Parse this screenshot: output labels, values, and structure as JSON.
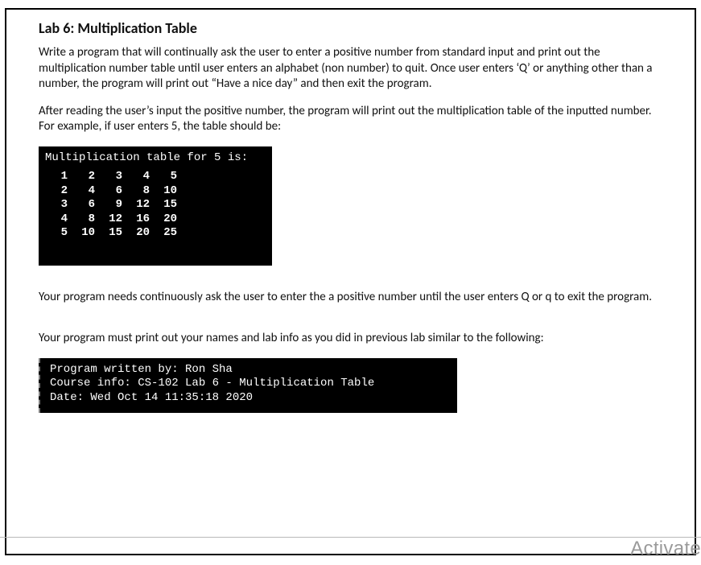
{
  "title": "Lab 6: Multiplication Table",
  "para1": "Write a program that will continually ask the user to enter a positive number from standard input and print out the multiplication number table until user enters an alphabet (non number) to quit.  Once user enters ‘Q’ or anything other than a number, the program will print out “Have a nice day” and then exit the program.",
  "para2": "After reading the user’s input the positive number, the program will print out the multiplication table of the inputted number.   For example, if user enters 5, the table should be:",
  "term1": {
    "header": "Multiplication table for 5 is:",
    "rows": [
      [
        "1",
        "2",
        "3",
        "4",
        "5"
      ],
      [
        "2",
        "4",
        "6",
        "8",
        "10"
      ],
      [
        "3",
        "6",
        "9",
        "12",
        "15"
      ],
      [
        "4",
        "8",
        "12",
        "16",
        "20"
      ],
      [
        "5",
        "10",
        "15",
        "20",
        "25"
      ]
    ]
  },
  "para3": "Your program needs continuously ask the user to enter the a positive number until the user enters Q or q to exit the program.",
  "para4": "Your program must print out your names and lab info as you did in previous lab similar to the following:",
  "term2": {
    "line1": "Program written by: Ron Sha",
    "line2": "Course info: CS-102 Lab 6 - Multiplication Table",
    "line3": "Date: Wed Oct 14 11:35:18 2020"
  },
  "watermark": "Activate "
}
